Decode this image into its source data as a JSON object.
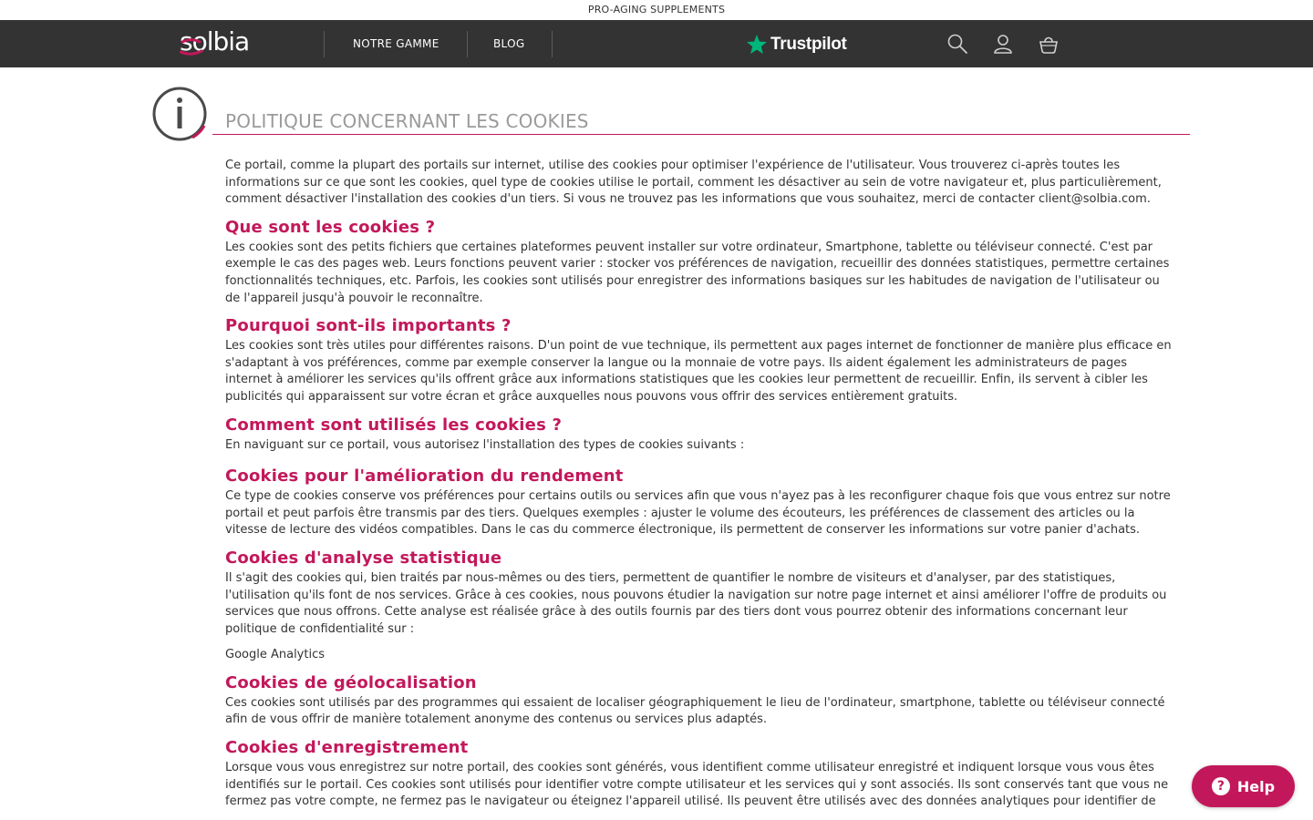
{
  "topbar": {
    "text": "PRO-AGING SUPPLEMENTS"
  },
  "nav": {
    "logo_text": "solbia",
    "links": [
      {
        "label": "NOTRE GAMME"
      },
      {
        "label": "BLOG"
      }
    ],
    "trustpilot": "Trustpilot",
    "icons": [
      "search-icon",
      "user-icon",
      "cart-icon"
    ]
  },
  "colors": {
    "accent": "#c2185b",
    "navbar": "#333333",
    "title": "#9a9a9a",
    "trustpilot_star": "#00b67a"
  },
  "page": {
    "title": "POLITIQUE CONCERNANT LES COOKIES",
    "intro": "Ce portail, comme la plupart des portails sur internet, utilise des cookies pour optimiser l'expérience de l'utilisateur. Vous trouverez ci-après toutes les informations sur ce que sont les cookies, quel type de cookies utilise le portail, comment les désactiver au sein de votre navigateur et, plus particulièrement, comment désactiver l'installation des cookies d'un tiers. Si vous ne trouvez pas les informations que vous souhaitez, merci de contacter client@solbia.com.",
    "sections": [
      {
        "heading": "Que sont les cookies ?",
        "body": "Les cookies sont des petits fichiers que certaines plateformes peuvent installer sur votre ordinateur, Smartphone, tablette ou téléviseur connecté. C'est par exemple le cas des pages web. Leurs fonctions peuvent varier : stocker vos préférences de navigation, recueillir des données statistiques, permettre certaines fonctionnalités techniques, etc. Parfois, les cookies sont utilisés pour enregistrer des informations basiques sur les habitudes de navigation de l'utilisateur ou de l'appareil jusqu'à pouvoir le reconnaître."
      },
      {
        "heading": "Pourquoi sont-ils importants ?",
        "body": "Les cookies sont très utiles pour différentes raisons. D'un point de vue technique, ils permettent aux pages internet de fonctionner de manière plus efficace en s'adaptant à vos préférences, comme par exemple conserver la langue ou la monnaie de votre pays. Ils aident également les administrateurs de pages internet à améliorer les services qu'ils offrent grâce aux informations statistiques que les cookies leur permettent de recueillir. Enfin, ils servent à cibler les publicités qui apparaissent sur votre écran et grâce auxquelles nous pouvons vous offrir des services entièrement gratuits."
      },
      {
        "heading": "Comment sont utilisés les cookies ?",
        "body": "En naviguant sur ce portail, vous autorisez l'installation des types de cookies suivants :"
      },
      {
        "heading": "Cookies pour l'amélioration du rendement",
        "body": "Ce type de cookies conserve vos préférences pour certains outils ou services afin que vous n'ayez pas à les reconfigurer chaque fois que vous entrez sur notre portail et peut parfois être transmis par des tiers. Quelques exemples : ajuster le volume des écouteurs, les préférences de classement des articles ou la vitesse de lecture des vidéos compatibles. Dans le cas du commerce électronique, ils permettent de conserver les informations sur votre panier d'achats."
      },
      {
        "heading": "Cookies d'analyse statistique",
        "body": "Il s'agit des cookies qui, bien traités par nous-mêmes ou des tiers, permettent de quantifier le nombre de visiteurs et d'analyser, par des statistiques, l'utilisation qu'ils font de nos services. Grâce à ces cookies, nous pouvons étudier la navigation sur notre page internet et ainsi améliorer l'offre de produits ou services que nous offrons. Cette analyse est réalisée grâce à des outils fournis par des tiers dont vous pourrez obtenir des informations concernant leur politique de confidentialité sur :",
        "extra": "Google Analytics"
      },
      {
        "heading": "Cookies de géolocalisation",
        "body": "Ces cookies sont utilisés par des programmes qui essaient de localiser géographiquement le lieu de l'ordinateur, smartphone, tablette ou téléviseur connecté afin de vous offrir de manière totalement anonyme des contenus ou services plus adaptés."
      },
      {
        "heading": "Cookies d'enregistrement",
        "body": "Lorsque vous vous enregistrez sur notre portail, des cookies sont générés, vous identifient comme utilisateur enregistré et indiquent lorsque vous vous êtes identifiés sur le portail. Ces cookies sont utilisés pour identifier votre compte utilisateur et les services qui y sont associés. Ils sont conservés tant que vous ne fermez pas votre compte, ne fermez pas le navigateur ou éteignez l'appareil utilisé. Ils peuvent être utilisés avec des données analytiques pour identifier de"
      }
    ]
  },
  "help": {
    "label": "Help"
  }
}
